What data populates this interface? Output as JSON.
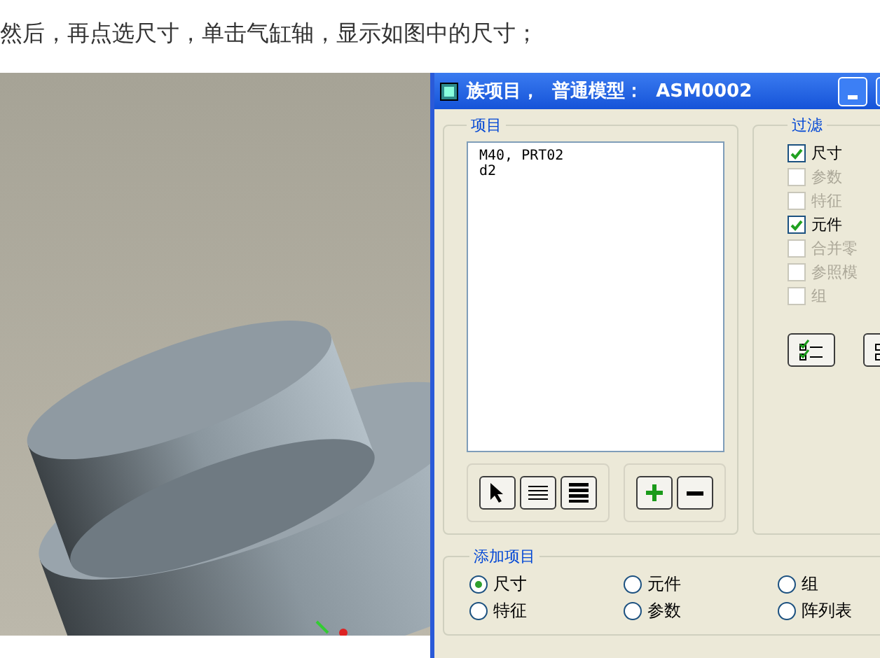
{
  "caption": "然后，再点选尺寸，单击气缸轴，显示如图中的尺寸；",
  "dialog": {
    "title": "族项目，  普通模型：  ASM0002",
    "items_group": {
      "label": "项目",
      "list": [
        "M40, PRT02",
        "d2"
      ]
    },
    "filter_group": {
      "label": "过滤",
      "options": [
        {
          "label": "尺寸",
          "checked": true,
          "disabled": false
        },
        {
          "label": "参数",
          "checked": false,
          "disabled": true
        },
        {
          "label": "特征",
          "checked": false,
          "disabled": true
        },
        {
          "label": "元件",
          "checked": true,
          "disabled": false
        },
        {
          "label": "合并零",
          "checked": false,
          "disabled": true
        },
        {
          "label": "参照模",
          "checked": false,
          "disabled": true
        },
        {
          "label": "组",
          "checked": false,
          "disabled": true
        }
      ]
    },
    "add_group": {
      "label": "添加项目",
      "options": [
        {
          "label": "尺寸",
          "selected": true
        },
        {
          "label": "元件",
          "selected": false
        },
        {
          "label": "组",
          "selected": false
        },
        {
          "label": "特征",
          "selected": false
        },
        {
          "label": "参数",
          "selected": false
        },
        {
          "label": "阵列表",
          "selected": false
        }
      ]
    }
  }
}
